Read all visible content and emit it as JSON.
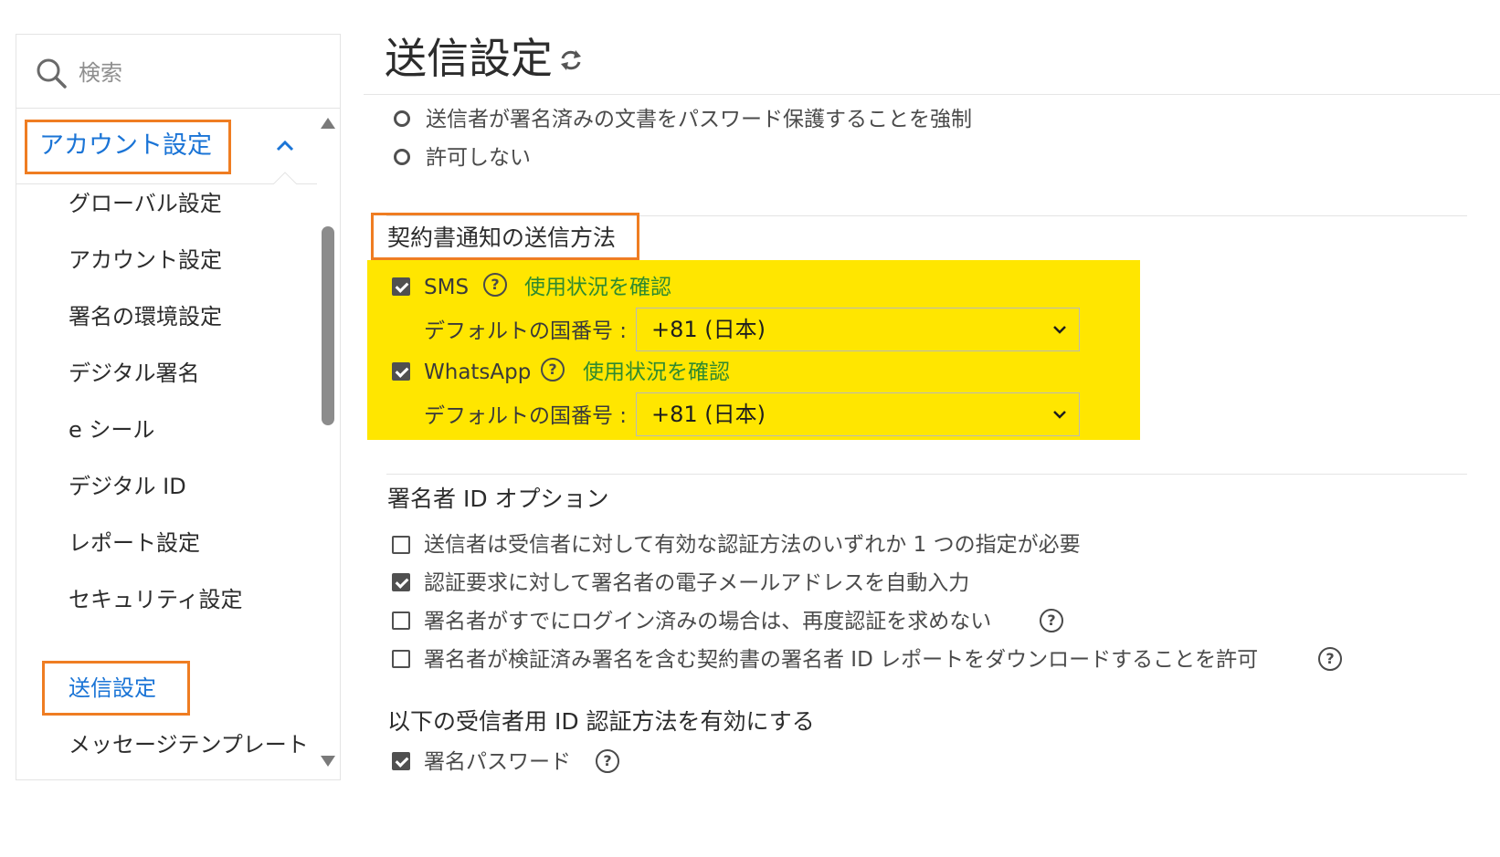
{
  "sidebar": {
    "search_placeholder": "検索",
    "section_label": "アカウント設定",
    "items": [
      {
        "label": "グローバル設定"
      },
      {
        "label": "アカウント設定"
      },
      {
        "label": "署名の環境設定"
      },
      {
        "label": "デジタル署名"
      },
      {
        "label": "e シール"
      },
      {
        "label": "デジタル ID"
      },
      {
        "label": "レポート設定"
      },
      {
        "label": "セキュリティ設定"
      },
      {
        "label": "送信設定",
        "active": true
      },
      {
        "label": "メッセージテンプレート"
      }
    ]
  },
  "page": {
    "title": "送信設定"
  },
  "password_options": [
    {
      "label": "送信者が署名済みの文書をパスワード保護することを強制",
      "selected": false
    },
    {
      "label": "許可しない",
      "selected": false
    }
  ],
  "notification": {
    "title": "契約書通知の送信方法",
    "sms": {
      "label": "SMS",
      "checked": true,
      "link": "使用状況を確認",
      "country_label": "デフォルトの国番号 :",
      "country_value": "+81 (日本)"
    },
    "whatsapp": {
      "label": "WhatsApp",
      "checked": true,
      "link": "使用状況を確認",
      "country_label": "デフォルトの国番号 :",
      "country_value": "+81 (日本)"
    }
  },
  "signer_id": {
    "title": "署名者 ID オプション",
    "options": [
      {
        "label": "送信者は受信者に対して有効な認証方法のいずれか 1 つの指定が必要",
        "checked": false
      },
      {
        "label": "認証要求に対して署名者の電子メールアドレスを自動入力",
        "checked": true
      },
      {
        "label": "署名者がすでにログイン済みの場合は、再度認証を求めない",
        "checked": false
      },
      {
        "label": "署名者が検証済み署名を含む契約書の署名者 ID レポートをダウンロードすることを許可",
        "checked": false
      }
    ]
  },
  "recipient_auth": {
    "title": "以下の受信者用 ID 認証方法を有効にする",
    "options": [
      {
        "label": "署名パスワード",
        "checked": true
      }
    ]
  },
  "colors": {
    "highlight_orange": "#ef7d22",
    "highlight_yellow": "#ffe600",
    "link_green": "#2f8a2f",
    "active_blue": "#1a74d6"
  },
  "icons": {
    "help": "?"
  }
}
